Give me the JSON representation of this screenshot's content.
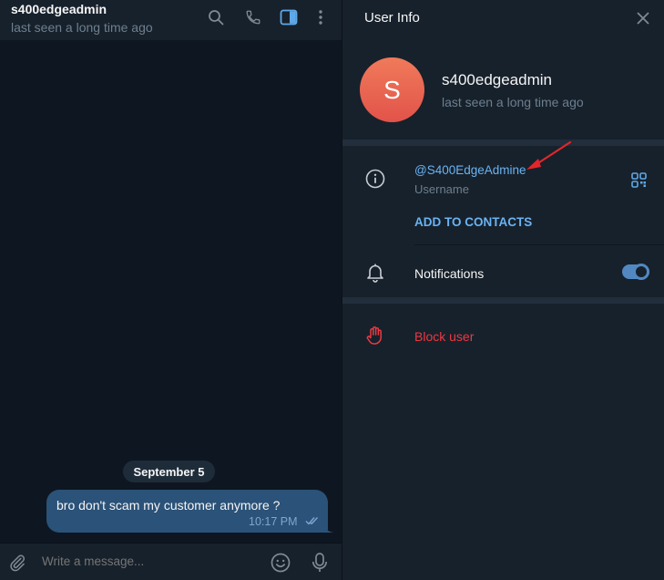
{
  "chat": {
    "title": "s400edgeadmin",
    "status": "last seen a long time ago",
    "header_icons": [
      "search-icon",
      "phone-icon",
      "sidebar-toggle-icon",
      "more-vertical-icon"
    ],
    "date_separator": "September 5",
    "message": {
      "text": "bro don't scam my customer anymore ?",
      "time": "10:17 PM",
      "status_icon": "double-check-icon"
    },
    "composer": {
      "placeholder": "Write a message...",
      "icons": [
        "attach-icon",
        "emoji-icon",
        "microphone-icon"
      ]
    }
  },
  "info_panel": {
    "title": "User Info",
    "avatar_letter": "S",
    "name": "s400edgeadmin",
    "status": "last seen a long time ago",
    "username": "@S400EdgeAdmine",
    "username_label": "Username",
    "add_contacts": "ADD TO CONTACTS",
    "notifications_label": "Notifications",
    "notifications_enabled": true,
    "block_label": "Block user"
  },
  "colors": {
    "chat_bg": "#0e1621",
    "panel_bg": "#17212b",
    "bubble_out": "#2b5278",
    "accent_link": "#6ab3f3",
    "danger": "#ec3942",
    "avatar": "#e8604f",
    "annotation_arrow": "#e3262b"
  }
}
